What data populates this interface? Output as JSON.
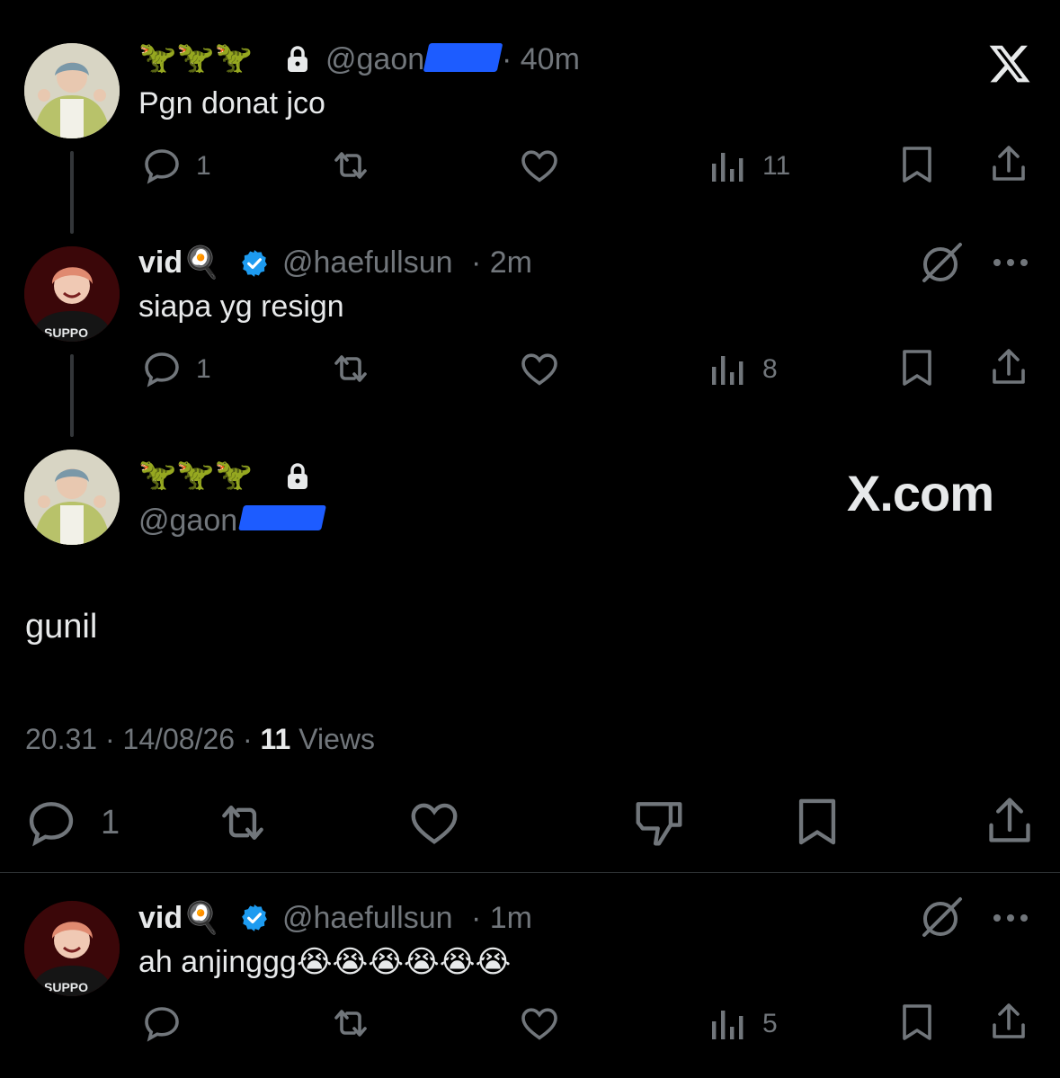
{
  "posts": [
    {
      "display_name": "🦖🦖🦖",
      "handle": "@gaon",
      "time": "· 40m",
      "text": "Pgn donat jco",
      "replies": "1",
      "views": "11"
    },
    {
      "display_name": "vid🍳",
      "handle": "@haefullsun",
      "time": "· 2m",
      "text": "siapa yg resign",
      "replies": "1",
      "views": "8"
    },
    {
      "display_name": "vid🍳",
      "handle": "@haefullsun",
      "time": "· 1m",
      "text": "ah anjinggg😭😭😭😭😭😭",
      "views": "5"
    }
  ],
  "main_post": {
    "display_name": "🦖🦖🦖",
    "handle": "@gaon",
    "text": "gunil",
    "timestamp": "20.31 · 14/08/26 ·",
    "views_count": "11",
    "views_label": "Views",
    "replies": "1"
  },
  "watermark": "X.com",
  "avatar_text": "SUPPO"
}
